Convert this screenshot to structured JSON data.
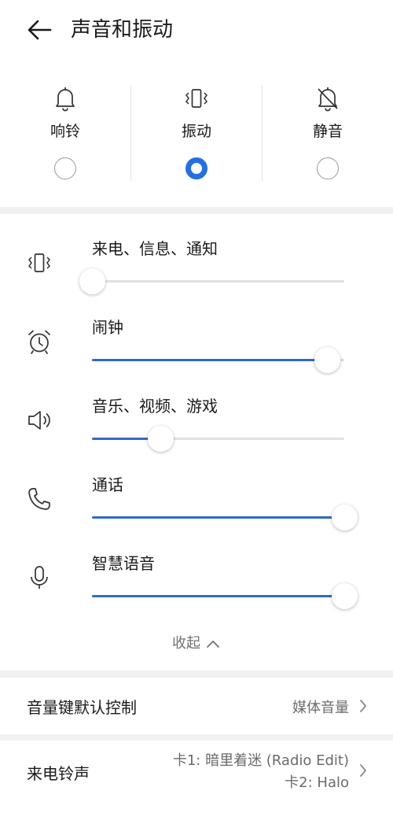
{
  "header": {
    "title": "声音和振动"
  },
  "modes": [
    {
      "label": "响铃",
      "selected": false,
      "icon": "bell-icon"
    },
    {
      "label": "振动",
      "selected": true,
      "icon": "vibrate-icon"
    },
    {
      "label": "静音",
      "selected": false,
      "icon": "bell-off-icon"
    }
  ],
  "volumes": [
    {
      "label": "来电、信息、通知",
      "icon": "vibrate-icon",
      "level": 0.0
    },
    {
      "label": "闹钟",
      "icon": "alarm-clock-icon",
      "level": 0.93
    },
    {
      "label": "音乐、视频、游戏",
      "icon": "speaker-icon",
      "level": 0.27
    },
    {
      "label": "通话",
      "icon": "phone-icon",
      "level": 1.0
    },
    {
      "label": "智慧语音",
      "icon": "microphone-icon",
      "level": 1.0
    }
  ],
  "collapse_label": "收起",
  "volume_key": {
    "label": "音量键默认控制",
    "value": "媒体音量"
  },
  "ringtone": {
    "label": "来电铃声",
    "card1": "卡1: 暗里着迷 (Radio Edit)",
    "card2": "卡2: Halo"
  },
  "colors": {
    "accent": "#256fe0",
    "slider_fill": "#2e6bc6",
    "background": "#f1f1f1"
  }
}
